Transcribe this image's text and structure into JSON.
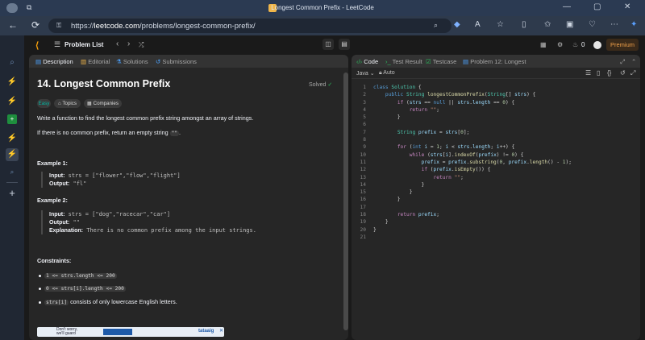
{
  "browser": {
    "tab_title": "Longest Common Prefix - LeetCode",
    "url_host": "leetcode.com",
    "url_path": "/problems/longest-common-prefix/",
    "url_scheme": "https://",
    "win_min": "—",
    "win_max": "▢",
    "win_close": "✕"
  },
  "lc": {
    "problem_list": "Problem List",
    "premium": "Premium",
    "streak": "0"
  },
  "tabs": {
    "description": "Description",
    "editorial": "Editorial",
    "solutions": "Solutions",
    "submissions": "Submissions"
  },
  "problem": {
    "title": "14. Longest Common Prefix",
    "status": "Solved",
    "chips": [
      "Easy",
      "Topics",
      "Companies"
    ],
    "statement": "Write a function to find the longest common prefix string amongst an array of strings.",
    "no_prefix_pre": "If there is no common prefix, return an empty string",
    "no_prefix_code": "\"\"",
    "no_prefix_post": ".",
    "example1_title": "Example 1:",
    "example1_input_label": "Input:",
    "example1_input": "strs = [\"flower\",\"flow\",\"flight\"]",
    "example1_output_label": "Output:",
    "example1_output": "\"fl\"",
    "example2_title": "Example 2:",
    "example2_input_label": "Input:",
    "example2_input": "strs = [\"dog\",\"racecar\",\"car\"]",
    "example2_output_label": "Output:",
    "example2_output": "\"\"",
    "example2_expl_label": "Explanation:",
    "example2_expl": "There is no common prefix among the input strings.",
    "constraints_title": "Constraints:",
    "c1": "1 <= strs.length <= 200",
    "c2": "0 <= strs[i].length <= 200",
    "c3_code": "strs[i]",
    "c3_text": "consists of only lowercase English letters."
  },
  "editor": {
    "tabs": [
      "Code",
      "Test Result",
      "Testcase",
      "Problem 12: Longest"
    ],
    "language": "Java",
    "auto": "Auto",
    "lines": [
      "class Solution {",
      "    public String longestCommonPrefix(String[] strs) {",
      "        if (strs == null || strs.length == 0) {",
      "            return \"\";",
      "        }",
      "",
      "        String prefix = strs[0];",
      "",
      "        for (int i = 1; i < strs.length; i++) {",
      "            while (strs[i].indexOf(prefix) != 0) {",
      "                prefix = prefix.substring(0, prefix.length() - 1);",
      "                if (prefix.isEmpty()) {",
      "                    return \"\";",
      "                }",
      "            }",
      "        }",
      "",
      "        return prefix;",
      "    }",
      "}",
      ""
    ]
  },
  "ad": {
    "text1": "Don't worry,",
    "text2": "we'll guard",
    "brand": "tataaig"
  },
  "colors": {
    "accent": "#f59e0b",
    "solved": "#2cbb5d",
    "easy": "#00b8a3"
  }
}
